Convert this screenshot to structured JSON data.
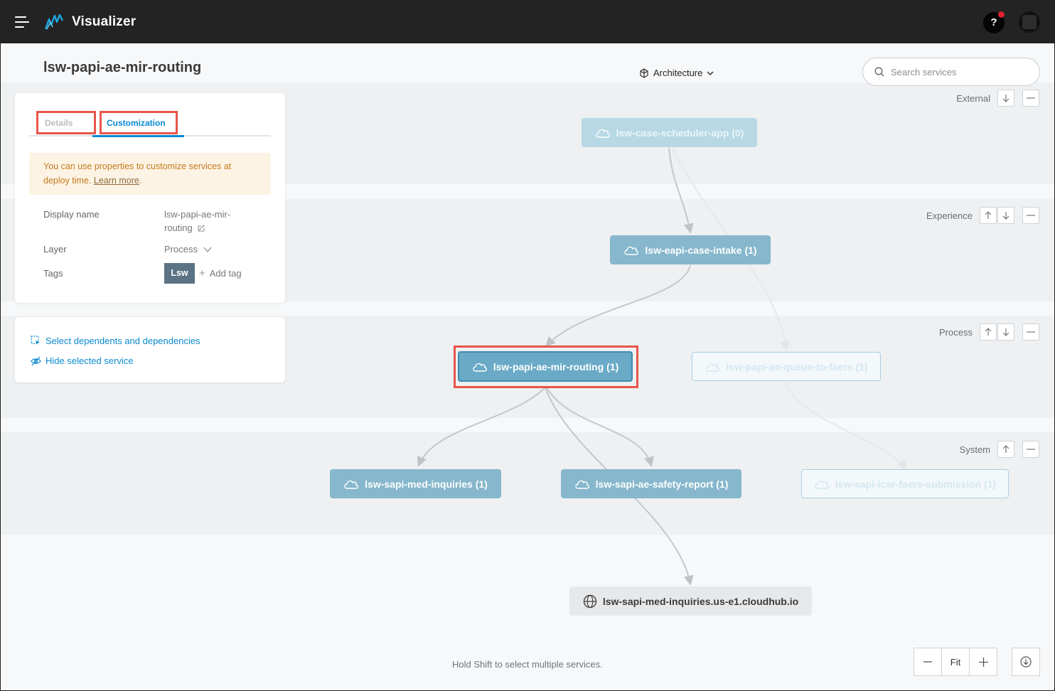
{
  "app": {
    "title": "Visualizer"
  },
  "page": {
    "title": "lsw-papi-ae-mir-routing"
  },
  "view_selector": {
    "label": "Architecture"
  },
  "search": {
    "placeholder": "Search services"
  },
  "layers": {
    "external": "External",
    "experience": "Experience",
    "process": "Process",
    "system": "System"
  },
  "details_panel": {
    "tabs": {
      "details": "Details",
      "customization": "Customization"
    },
    "notice": {
      "text": "You can use properties to customize services at deploy time.",
      "link": "Learn more",
      "suffix": "."
    },
    "fields": {
      "display_name_label": "Display name",
      "display_name_line1": "lsw-papi-ae-mir-",
      "display_name_line2": "routing",
      "layer_label": "Layer",
      "layer_value": "Process",
      "tags_label": "Tags",
      "tag_chip": "Lsw",
      "add_tag": "Add tag"
    }
  },
  "actions_panel": {
    "select_deps": "Select dependents and dependencies",
    "hide_service": "Hide selected service"
  },
  "nodes": {
    "case_scheduler": "lsw-case-scheduler-app (0)",
    "eapi_case_intake": "lsw-eapi-case-intake (1)",
    "papi_mir_routing": "lsw-papi-ae-mir-routing (1)",
    "papi_queue_faers": "lsw-papi-ae-queue-to-faers (1)",
    "sapi_med_inquiries": "lsw-sapi-med-inquiries (1)",
    "sapi_safety_report": "lsw-sapi-ae-safety-report (1)",
    "sapi_icsr_faers": "lsw-sapi-icsr-faers-submission (1)",
    "external_cloudhub": "lsw-sapi-med-inquiries.us-e1.cloudhub.io"
  },
  "footer": {
    "hint": "Hold Shift to select multiple services.",
    "zoom_fit": "Fit"
  },
  "colors": {
    "accent": "#0a8ad0",
    "highlight": "#e8554a",
    "node_selected": "#6aaac7",
    "node_default": "#86b7cc"
  }
}
